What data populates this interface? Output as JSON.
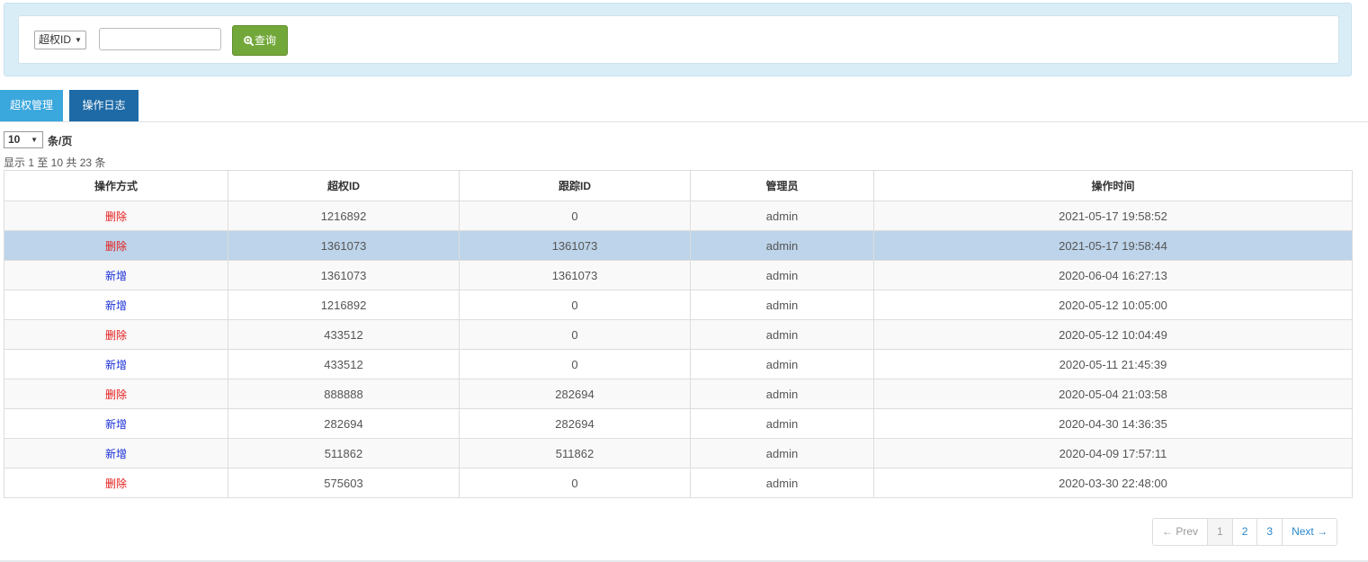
{
  "search": {
    "type_select": {
      "selected": "超权ID"
    },
    "input": {
      "value": "",
      "placeholder": ""
    },
    "button_label": "查询"
  },
  "tabs": [
    {
      "label": "超权管理"
    },
    {
      "label": "操作日志"
    }
  ],
  "length": {
    "selected": "10",
    "unit": "条/页"
  },
  "info": "显示 1 至 10 共 23 条",
  "table": {
    "headers": [
      "操作方式",
      "超权ID",
      "跟踪ID",
      "管理员",
      "操作时间"
    ],
    "rows": [
      {
        "action": "删除",
        "super_id": "1216892",
        "track_id": "0",
        "admin": "admin",
        "time": "2021-05-17 19:58:52"
      },
      {
        "action": "删除",
        "super_id": "1361073",
        "track_id": "1361073",
        "admin": "admin",
        "time": "2021-05-17 19:58:44"
      },
      {
        "action": "新增",
        "super_id": "1361073",
        "track_id": "1361073",
        "admin": "admin",
        "time": "2020-06-04 16:27:13"
      },
      {
        "action": "新增",
        "super_id": "1216892",
        "track_id": "0",
        "admin": "admin",
        "time": "2020-05-12 10:05:00"
      },
      {
        "action": "删除",
        "super_id": "433512",
        "track_id": "0",
        "admin": "admin",
        "time": "2020-05-12 10:04:49"
      },
      {
        "action": "新增",
        "super_id": "433512",
        "track_id": "0",
        "admin": "admin",
        "time": "2020-05-11 21:45:39"
      },
      {
        "action": "删除",
        "super_id": "888888",
        "track_id": "282694",
        "admin": "admin",
        "time": "2020-05-04 21:03:58"
      },
      {
        "action": "新增",
        "super_id": "282694",
        "track_id": "282694",
        "admin": "admin",
        "time": "2020-04-30 14:36:35"
      },
      {
        "action": "新增",
        "super_id": "511862",
        "track_id": "511862",
        "admin": "admin",
        "time": "2020-04-09 17:57:11"
      },
      {
        "action": "删除",
        "super_id": "575603",
        "track_id": "0",
        "admin": "admin",
        "time": "2020-03-30 22:48:00"
      }
    ]
  },
  "pagination": {
    "prev": "← Prev",
    "pages": [
      "1",
      "2",
      "3"
    ],
    "next": "Next →"
  },
  "colors": {
    "delete_action": "#e31b1b",
    "add_action": "#1a2fd6",
    "search_button": "#72a83a",
    "tab_active": "#1d6aa6",
    "tab_inactive": "#3aa7dd",
    "selected_row": "#bdd4ea"
  },
  "icons": {
    "search_button_icon": "zoom-in-icon"
  }
}
